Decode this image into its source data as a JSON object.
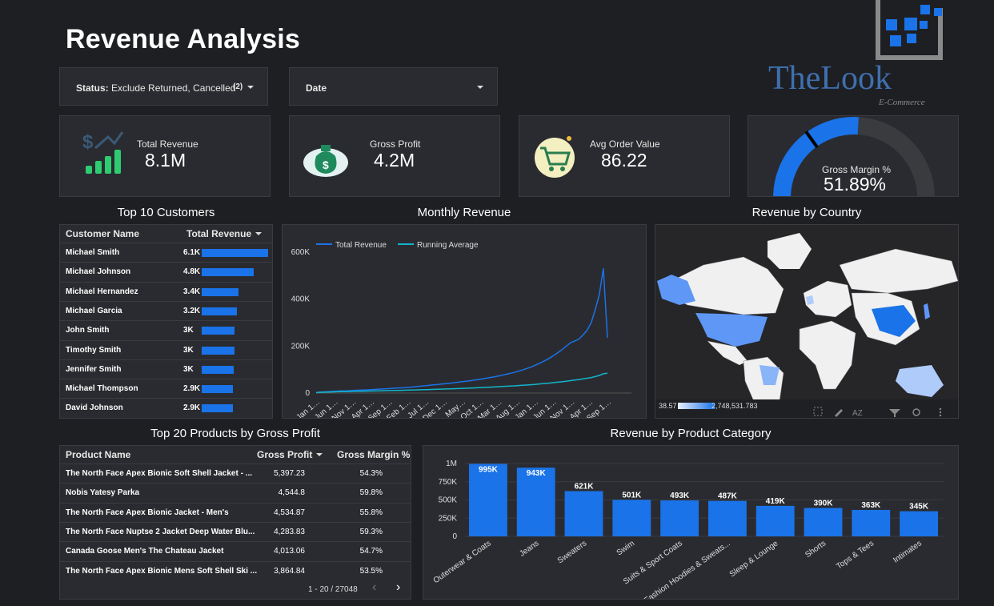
{
  "header": {
    "title": "Revenue Analysis"
  },
  "filters": {
    "status_label": "Status:",
    "status_value": "Exclude Returned, Cancelled",
    "status_count": "(2)",
    "date_label": "Date"
  },
  "logo": {
    "name": "TheLook",
    "subtitle": "E-Commerce"
  },
  "kpis": {
    "total_revenue": {
      "label": "Total Revenue",
      "value": "8.1M"
    },
    "gross_profit": {
      "label": "Gross Profit",
      "value": "4.2M"
    },
    "aov": {
      "label": "Avg Order Value",
      "value": "86.22"
    },
    "gross_margin": {
      "label": "Gross Margin %",
      "value": "51.89%",
      "fraction": 0.5189
    }
  },
  "customers": {
    "title": "Top 10 Customers",
    "col_name": "Customer Name",
    "col_revenue": "Total Revenue",
    "rows": [
      {
        "name": "Michael Smith",
        "label": "6.1K",
        "value": 6100
      },
      {
        "name": "Michael Johnson",
        "label": "4.8K",
        "value": 4800
      },
      {
        "name": "Michael Hernandez",
        "label": "3.4K",
        "value": 3400
      },
      {
        "name": "Michael Garcia",
        "label": "3.2K",
        "value": 3200
      },
      {
        "name": "John Smith",
        "label": "3K",
        "value": 3000
      },
      {
        "name": "Timothy Smith",
        "label": "3K",
        "value": 3000
      },
      {
        "name": "Jennifer Smith",
        "label": "3K",
        "value": 2950
      },
      {
        "name": "Michael Thompson",
        "label": "2.9K",
        "value": 2900
      },
      {
        "name": "David Johnson",
        "label": "2.9K",
        "value": 2850
      }
    ]
  },
  "monthly": {
    "title": "Monthly Revenue",
    "legend": [
      "Total Revenue",
      "Running Average"
    ],
    "colors": [
      "#1a73e8",
      "#12b5cb"
    ],
    "y_ticks": [
      "0",
      "200K",
      "400K",
      "600K"
    ],
    "x_ticks": [
      "Jan 1…",
      "Jun 1…",
      "Nov 1…",
      "Apr 1…",
      "Sep 1…",
      "Feb 1…",
      "Jul 1…",
      "Dec 1…",
      "May…",
      "Oct 1…",
      "Mar 1…",
      "Aug 1…",
      "Jan 1…",
      "Jun 1…",
      "Nov 1…",
      "Apr 1…",
      "Sep 1…"
    ]
  },
  "country": {
    "title": "Revenue by Country",
    "scale_min": "38.57",
    "scale_max": "2,748,531.783"
  },
  "products": {
    "title": "Top 20 Products by Gross Profit",
    "col_name": "Product Name",
    "col_profit": "Gross Profit",
    "col_margin": "Gross Margin %",
    "rows": [
      {
        "name": "The North Face Apex Bionic Soft Shell Jacket - ...",
        "profit": "5,397.23",
        "margin": "54.3%"
      },
      {
        "name": "Nobis Yatesy Parka",
        "profit": "4,544.8",
        "margin": "59.8%"
      },
      {
        "name": "The North Face Apex Bionic Jacket - Men's",
        "profit": "4,534.87",
        "margin": "55.8%"
      },
      {
        "name": "The North Face Nuptse 2 Jacket Deep Water Blu...",
        "profit": "4,283.83",
        "margin": "59.3%"
      },
      {
        "name": "Canada Goose Men's The Chateau Jacket",
        "profit": "4,013.06",
        "margin": "54.7%"
      },
      {
        "name": "The North Face Apex Bionic Mens Soft Shell Ski ...",
        "profit": "3,864.84",
        "margin": "53.5%"
      }
    ],
    "pagination": "1 - 20 / 27048"
  },
  "category": {
    "title": "Revenue by Product Category",
    "y_ticks": [
      "0",
      "250K",
      "500K",
      "750K",
      "1M"
    ]
  },
  "chart_data": [
    {
      "type": "line",
      "title": "Monthly Revenue",
      "series": [
        {
          "name": "Total Revenue",
          "values": [
            2000,
            4000,
            5000,
            6000,
            7000,
            8000,
            9000,
            9000,
            10000,
            11000,
            12000,
            13000,
            13000,
            14000,
            15000,
            16000,
            17000,
            18000,
            19000,
            20000,
            21000,
            22000,
            23000,
            25000,
            26000,
            28000,
            30000,
            31000,
            33000,
            35000,
            36000,
            38000,
            40000,
            42000,
            44000,
            46000,
            48000,
            50000,
            52000,
            55000,
            57000,
            60000,
            63000,
            66000,
            69000,
            72000,
            76000,
            80000,
            84000,
            88000,
            93000,
            98000,
            104000,
            110000,
            117000,
            125000,
            133000,
            142000,
            152000,
            163000,
            175000,
            188000,
            202000,
            215000,
            222000,
            230000,
            248000,
            268000,
            300000,
            355000,
            420000,
            530000,
            235000
          ]
        },
        {
          "name": "Running Average",
          "values": [
            2000,
            3000,
            3700,
            4300,
            4800,
            5300,
            5800,
            6200,
            6600,
            7000,
            7400,
            7800,
            8100,
            8500,
            8900,
            9300,
            9700,
            10100,
            10500,
            10900,
            11300,
            11700,
            12100,
            12600,
            13000,
            13500,
            14000,
            14500,
            15000,
            15600,
            16100,
            16700,
            17300,
            17900,
            18500,
            19200,
            19800,
            20500,
            21200,
            21900,
            22700,
            23500,
            24300,
            25100,
            26000,
            26900,
            27800,
            28800,
            29800,
            30800,
            31900,
            33000,
            34200,
            35500,
            36800,
            38200,
            39700,
            41300,
            43000,
            44800,
            46700,
            48700,
            50800,
            53000,
            55300,
            57700,
            60200,
            63000,
            66200,
            70000,
            75000,
            82000,
            84000
          ]
        }
      ],
      "ylim": [
        0,
        640000
      ]
    },
    {
      "type": "bar",
      "title": "Revenue by Product Category",
      "categories": [
        "Outerwear & Coats",
        "Jeans",
        "Sweaters",
        "Swim",
        "Suits & Sport Coats",
        "Fashion Hoodies & Sweats...",
        "Sleep & Lounge",
        "Shorts",
        "Tops & Tees",
        "Intimates"
      ],
      "values": [
        995000,
        943000,
        621000,
        501000,
        493000,
        487000,
        419000,
        390000,
        363000,
        345000
      ],
      "labels": [
        "995K",
        "943K",
        "621K",
        "501K",
        "493K",
        "487K",
        "419K",
        "390K",
        "363K",
        "345K"
      ],
      "ylim": [
        0,
        1000000
      ]
    },
    {
      "type": "bar",
      "title": "Top 10 Customers",
      "categories": [
        "Michael Smith",
        "Michael Johnson",
        "Michael Hernandez",
        "Michael Garcia",
        "John Smith",
        "Timothy Smith",
        "Jennifer Smith",
        "Michael Thompson",
        "David Johnson"
      ],
      "values": [
        6100,
        4800,
        3400,
        3200,
        3000,
        3000,
        2950,
        2900,
        2850
      ]
    }
  ]
}
